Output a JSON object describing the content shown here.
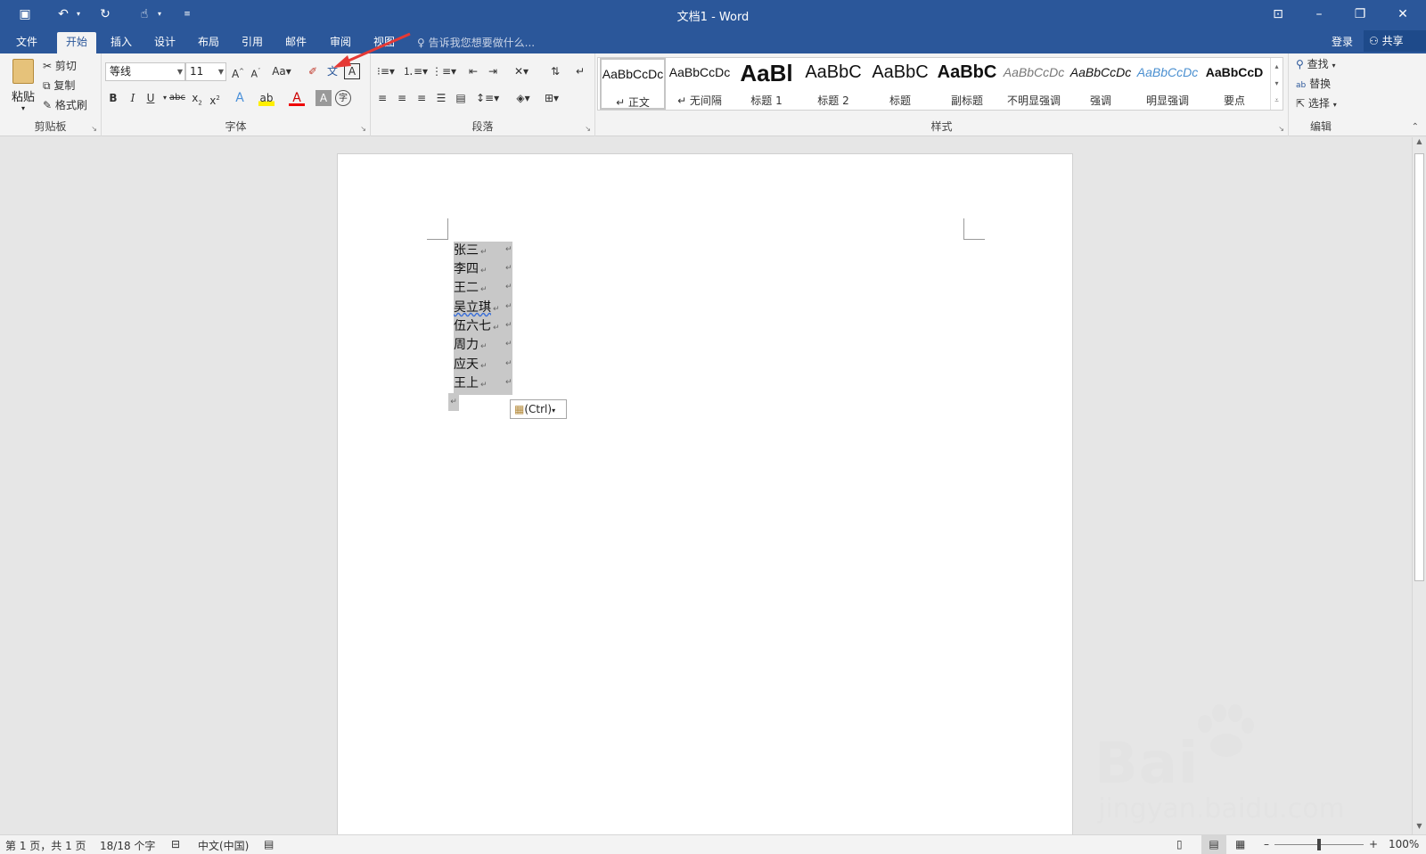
{
  "window": {
    "title": "文档1 - Word",
    "signin": "登录",
    "share": "共享"
  },
  "tabs": [
    {
      "label": "文件"
    },
    {
      "label": "开始"
    },
    {
      "label": "插入"
    },
    {
      "label": "设计"
    },
    {
      "label": "布局"
    },
    {
      "label": "引用"
    },
    {
      "label": "邮件"
    },
    {
      "label": "审阅"
    },
    {
      "label": "视图"
    }
  ],
  "tellme": "告诉我您想要做什么...",
  "clipboard": {
    "paste": "粘贴",
    "cut": "剪切",
    "copy": "复制",
    "format_painter": "格式刷",
    "label": "剪贴板"
  },
  "font": {
    "name": "等线",
    "size": "11",
    "label": "字体"
  },
  "paragraph": {
    "label": "段落"
  },
  "styles": {
    "label": "样式",
    "items": [
      {
        "preview": "AaBbCcDc",
        "name": "↵ 正文"
      },
      {
        "preview": "AaBbCcDc",
        "name": "↵ 无间隔"
      },
      {
        "preview": "AaBl",
        "name": "标题 1"
      },
      {
        "preview": "AaBbC",
        "name": "标题 2"
      },
      {
        "preview": "AaBbC",
        "name": "标题"
      },
      {
        "preview": "AaBbC",
        "name": "副标题"
      },
      {
        "preview": "AaBbCcDc",
        "name": "不明显强调"
      },
      {
        "preview": "AaBbCcDc",
        "name": "强调"
      },
      {
        "preview": "AaBbCcDc",
        "name": "明显强调"
      },
      {
        "preview": "AaBbCcD",
        "name": "要点"
      }
    ]
  },
  "editing": {
    "find": "查找",
    "replace": "替换",
    "select": "选择",
    "label": "编辑"
  },
  "document": {
    "lines": [
      "张三",
      "李四",
      "王二",
      "吴立琪",
      "伍六七",
      "周力",
      "应天",
      "王上"
    ],
    "paste_options": "(Ctrl)"
  },
  "status": {
    "page": "第 1 页，共 1 页",
    "words": "18/18 个字",
    "language": "中文(中国)",
    "zoom": "100%"
  },
  "watermark": {
    "line1": "Bai",
    "line2": "jingyan.baidu.com"
  },
  "colors": {
    "accent": "#2b579a",
    "arrow": "#e53935"
  }
}
